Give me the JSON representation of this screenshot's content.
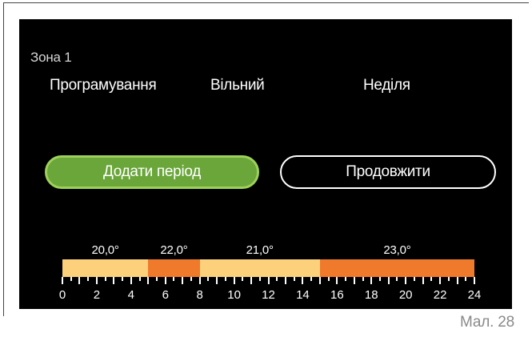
{
  "zone": {
    "title": "Зона 1"
  },
  "info": {
    "mode": "Програмування",
    "status": "Вільний",
    "day": "Неділя"
  },
  "buttons": {
    "add_period": "Додати період",
    "continue": "Продовжити"
  },
  "schedule": {
    "axis_min": 0,
    "axis_max": 24,
    "tick_labels": [
      "0",
      "2",
      "4",
      "6",
      "8",
      "10",
      "12",
      "14",
      "16",
      "18",
      "20",
      "22",
      "24"
    ],
    "periods": [
      {
        "start": 0,
        "end": 5,
        "temp": "20,0°",
        "color": "#fdd07b"
      },
      {
        "start": 5,
        "end": 8,
        "temp": "22,0°",
        "color": "#f07a2c"
      },
      {
        "start": 8,
        "end": 15,
        "temp": "21,0°",
        "color": "#fdd07b"
      },
      {
        "start": 15,
        "end": 24,
        "temp": "23,0°",
        "color": "#f07a2c"
      }
    ]
  },
  "caption": "Мал. 28"
}
